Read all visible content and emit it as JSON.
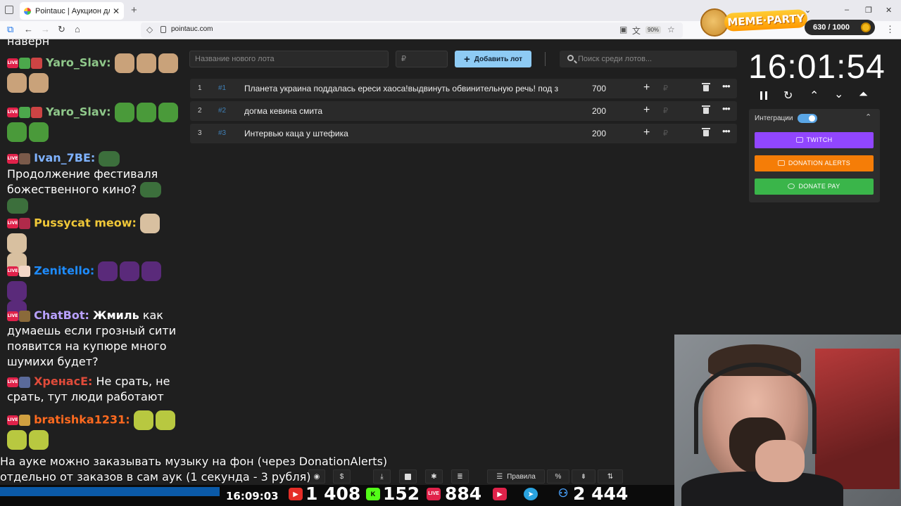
{
  "browser": {
    "tab_title": "Pointauc | Аукцион для стриме",
    "url": "pointauc.com",
    "zoom": "90%"
  },
  "overlay": {
    "logo": "MEME·PARTY",
    "counter": "630 / 1000"
  },
  "chat": {
    "messages": [
      {
        "nick": "Yaro_Slav:",
        "text": "",
        "nick_color": "#8fc88a"
      },
      {
        "nick": "Yaro_Slav:",
        "text": "",
        "nick_color": "#8fc88a"
      },
      {
        "nick": "Ivan_7BE:",
        "text": "Продолжение фестиваля божественного кино?",
        "nick_color": "#7fb2ff"
      },
      {
        "nick": "Pussycat meow:",
        "text": "",
        "nick_color": "#f0c838"
      },
      {
        "nick": "Zenitello:",
        "text": "",
        "nick_color": "#1e8cff"
      },
      {
        "nick": "ChatBot:",
        "mention": "Жмиль",
        "text": "как думаешь если грозный сити появится на купюре много шумихи будет?",
        "nick_color": "#b8a0ff"
      },
      {
        "nick": "ХренасЕ:",
        "text": "Не срать, не срать, тут люди работают",
        "nick_color": "#e04b3a"
      },
      {
        "nick": "bratishka1231:",
        "text": "",
        "nick_color": "#ff6a1f"
      }
    ]
  },
  "lots": {
    "new_lot_placeholder": "Название нового лота",
    "amount_placeholder": "₽",
    "add_button": "Добавить лот",
    "search_placeholder": "Поиск среди лотов...",
    "items": [
      {
        "n": "1",
        "id": "#1",
        "name": "Планета украина поддалась ереси хаоса!выдвинуть обвинительную речь! под з",
        "amount": "700"
      },
      {
        "n": "2",
        "id": "#2",
        "name": "догма кевина смита",
        "amount": "200"
      },
      {
        "n": "3",
        "id": "#3",
        "name": "Интервью каца у штефика",
        "amount": "200"
      }
    ]
  },
  "timer": {
    "value": "16:01:54"
  },
  "integrations": {
    "label": "Интеграции",
    "enabled": true,
    "twitch": "TWITCH",
    "donation_alerts": "DONATION ALERTS",
    "donate_pay": "DONATE PAY",
    "colors": {
      "twitch": "#9146ff",
      "donation_alerts": "#f57d07",
      "donate_pay": "#3ab54a"
    }
  },
  "toolbar": {
    "rules": "Правила",
    "percent": "%",
    "dollar": "$"
  },
  "stream": {
    "caption_line1": "На ауке можно заказывать музыку на фон (через DonationAlerts)",
    "caption_line2": "отдельно от заказов в сам аук (1 секунда - 3 рубля)",
    "clock": "16:09:03",
    "youtube_viewers": "1 408",
    "kick_viewers": "152",
    "live_viewers": "884",
    "total_viewers": "2 444"
  }
}
